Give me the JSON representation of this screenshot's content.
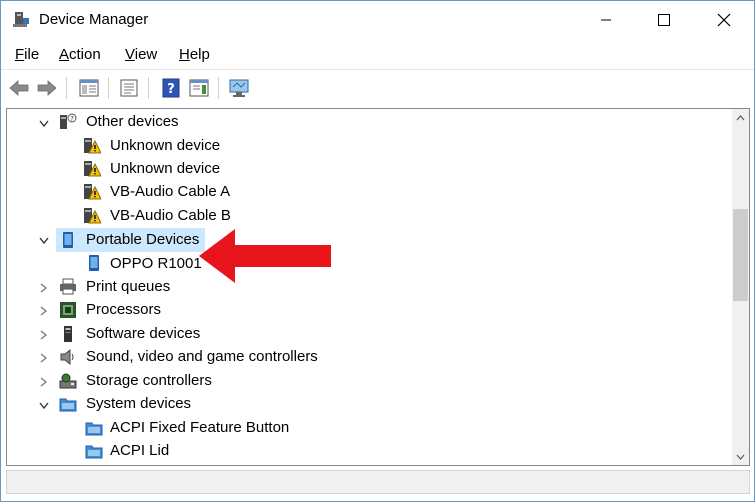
{
  "window": {
    "title": "Device Manager"
  },
  "menu": [
    {
      "label": "File",
      "accel": "F",
      "rest": "ile"
    },
    {
      "label": "Action",
      "accel": "A",
      "rest": "ction"
    },
    {
      "label": "View",
      "accel": "V",
      "rest": "iew"
    },
    {
      "label": "Help",
      "accel": "H",
      "rest": "elp"
    }
  ],
  "tree": {
    "other_devices": "Other devices",
    "unknown_1": "Unknown device",
    "unknown_2": "Unknown device",
    "vb_a": "VB-Audio Cable A",
    "vb_b": "VB-Audio Cable B",
    "portable": "Portable Devices",
    "oppo": "OPPO R1001",
    "print_queues": "Print queues",
    "processors": "Processors",
    "software": "Software devices",
    "sound": "Sound, video and game controllers",
    "storage": "Storage controllers",
    "system": "System devices",
    "acpi_fixed": "ACPI Fixed Feature Button",
    "acpi_lid": "ACPI Lid"
  },
  "colors": {
    "selection": "#cce8ff",
    "arrow": "#e8141c"
  }
}
